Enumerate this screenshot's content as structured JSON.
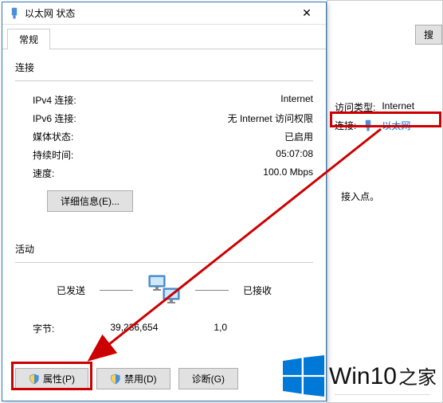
{
  "dialog": {
    "title": "以太网 状态",
    "tab_general": "常规",
    "section_connection": "连接",
    "rows": {
      "ipv4_label": "IPv4 连接:",
      "ipv4_value": "Internet",
      "ipv6_label": "IPv6 连接:",
      "ipv6_value": "无 Internet 访问权限",
      "media_label": "媒体状态:",
      "media_value": "已启用",
      "duration_label": "持续时间:",
      "duration_value": "05:07:08",
      "speed_label": "速度:",
      "speed_value": "100.0 Mbps"
    },
    "details_btn": "详细信息(E)...",
    "section_activity": "活动",
    "activity": {
      "sent": "已发送",
      "received": "已接收",
      "bytes_label": "字节:",
      "bytes_sent": "39,236,654",
      "bytes_received": "1,0"
    },
    "buttons": {
      "properties": "属性(P)",
      "disable": "禁用(D)",
      "diagnose": "诊断(G)"
    }
  },
  "background": {
    "search_btn": "搜",
    "access_type_label": "访问类型:",
    "access_type_value": "Internet",
    "connections_label": "连接:",
    "connection_link": "以太网",
    "access_point_text": "接入点。"
  },
  "watermark": {
    "brand_a": "Win",
    "brand_b": "10",
    "brand_c": "之家"
  }
}
